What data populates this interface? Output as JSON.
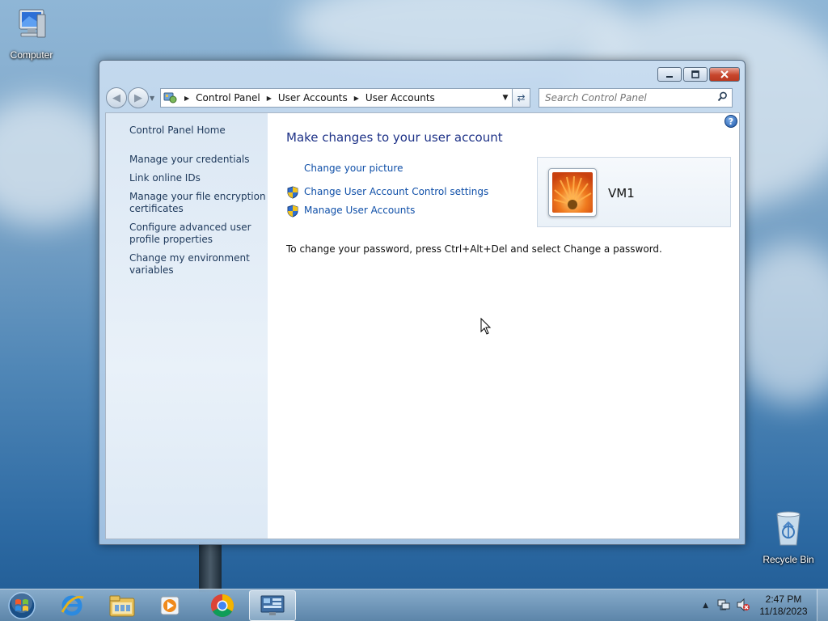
{
  "desktop": {
    "icons": [
      {
        "label": "Computer",
        "icon": "computer-icon"
      },
      {
        "label": "Recycle Bin",
        "icon": "recycle-bin-icon"
      }
    ]
  },
  "window": {
    "caption_buttons": [
      "minimize",
      "restore",
      "close"
    ],
    "address_bar": {
      "breadcrumbs": [
        "Control Panel",
        "User Accounts",
        "User Accounts"
      ]
    },
    "search": {
      "placeholder": "Search Control Panel"
    },
    "sidebar": {
      "items": [
        {
          "label": "Control Panel Home"
        },
        {
          "label": "Manage your credentials"
        },
        {
          "label": "Link online IDs"
        },
        {
          "label": "Manage your file encryption certificates"
        },
        {
          "label": "Configure advanced user profile properties"
        },
        {
          "label": "Change my environment variables"
        }
      ]
    },
    "main": {
      "title": "Make changes to your user account",
      "tasks": [
        {
          "label": "Change your picture",
          "shield": false
        },
        {
          "label": "Change User Account Control settings",
          "shield": true
        },
        {
          "label": "Manage User Accounts",
          "shield": true
        }
      ],
      "password_note": "To change your password, press Ctrl+Alt+Del and select Change a password.",
      "account": {
        "name": "VM1",
        "picture": "orange-flower"
      }
    }
  },
  "taskbar": {
    "pinned": [
      "internet-explorer-icon",
      "file-explorer-icon",
      "media-player-icon",
      "chrome-icon",
      "control-panel-icon"
    ],
    "active": "control-panel-icon",
    "clock": {
      "time": "2:47 PM",
      "date": "11/18/2023"
    }
  },
  "colors": {
    "link": "#0f4fa8",
    "title": "#1e3287",
    "sidebar_link": "#1e395b"
  }
}
